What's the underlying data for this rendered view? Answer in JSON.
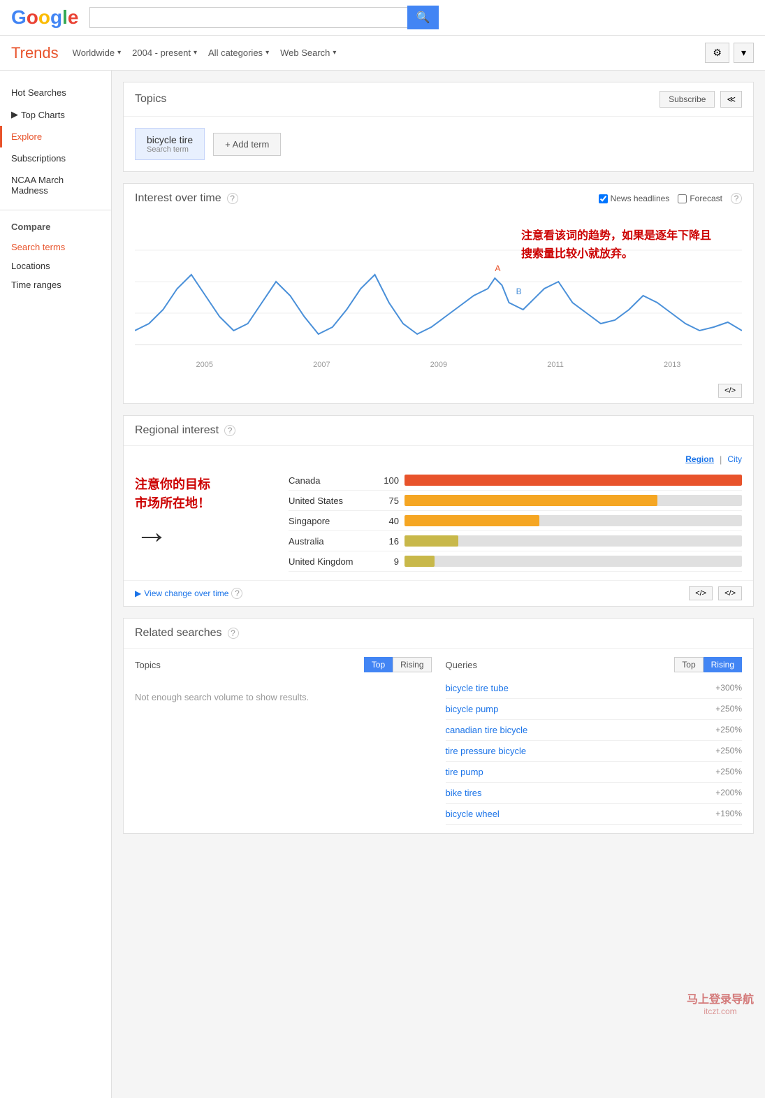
{
  "header": {
    "search_placeholder": "",
    "search_btn_icon": "🔍"
  },
  "google_logo": {
    "text": "Google"
  },
  "trends_bar": {
    "logo": "Trends",
    "nav": [
      {
        "label": "Worldwide",
        "has_arrow": true
      },
      {
        "label": "2004 - present",
        "has_arrow": true
      },
      {
        "label": "All categories",
        "has_arrow": true
      },
      {
        "label": "Web Search",
        "has_arrow": true
      }
    ],
    "settings_icon": "⚙",
    "arrow_icon": "▾"
  },
  "sidebar": {
    "items": [
      {
        "label": "Hot Searches",
        "active": false
      },
      {
        "label": "Top Charts",
        "active": false,
        "has_arrow": true
      },
      {
        "label": "Explore",
        "active": true
      },
      {
        "label": "Subscriptions",
        "active": false
      },
      {
        "label": "NCAA March Madness",
        "active": false
      }
    ],
    "compare_label": "Compare",
    "compare_items": [
      {
        "label": "Search terms",
        "active": true
      },
      {
        "label": "Locations",
        "active": false
      },
      {
        "label": "Time ranges",
        "active": false
      }
    ]
  },
  "topics": {
    "title": "Topics",
    "subscribe_btn": "Subscribe",
    "share_icon": "≪",
    "term": {
      "name": "bicycle tire",
      "type": "Search term"
    },
    "add_term_btn": "+ Add term"
  },
  "interest_over_time": {
    "title": "Interest over time",
    "question_icon": "?",
    "news_headlines_label": "News headlines",
    "forecast_label": "Forecast",
    "question_icon2": "?",
    "annotation": "注意看该词的趋势，如果是逐年下降且\n搜索量比较小就放弃。",
    "years": [
      "2005",
      "2007",
      "2009",
      "2011",
      "2013"
    ],
    "embed_icon": "</>",
    "news_checked": true,
    "forecast_checked": false
  },
  "regional_interest": {
    "title": "Regional interest",
    "question_icon": "?",
    "region_label": "Region",
    "city_label": "City",
    "annotation_text": "注意你的目标\n市场所在地！",
    "arrow": "→",
    "countries": [
      {
        "name": "Canada",
        "score": 100,
        "bar_pct": 100,
        "color": "#e8532b"
      },
      {
        "name": "United States",
        "score": 75,
        "bar_pct": 75,
        "color": "#f5a623"
      },
      {
        "name": "Singapore",
        "score": 40,
        "bar_pct": 40,
        "color": "#f5a623"
      },
      {
        "name": "Australia",
        "score": 16,
        "bar_pct": 16,
        "color": "#c8b84a"
      },
      {
        "name": "United Kingdom",
        "score": 9,
        "bar_pct": 9,
        "color": "#c8b84a"
      }
    ],
    "view_change_label": "View change over time",
    "question_icon2": "?",
    "embed_icon": "</>",
    "embed_icon2": "</>"
  },
  "related_searches": {
    "title": "Related searches",
    "question_icon": "?",
    "topics_label": "Topics",
    "top_btn": "Top",
    "rising_btn": "Rising",
    "queries_label": "Queries",
    "top_btn2": "Top",
    "rising_btn2": "Rising",
    "no_data": "Not enough search volume to show results.",
    "queries": [
      {
        "term": "bicycle tire tube",
        "pct": "+300%"
      },
      {
        "term": "bicycle pump",
        "pct": "+250%"
      },
      {
        "term": "canadian tire bicycle",
        "pct": "+250%"
      },
      {
        "term": "tire pressure bicycle",
        "pct": "+250%"
      },
      {
        "term": "tire pump",
        "pct": "+250%"
      },
      {
        "term": "bike tires",
        "pct": "+200%"
      },
      {
        "term": "bicycle wheel",
        "pct": "+190%"
      }
    ]
  },
  "watermark": {
    "line1": "马上登录导航",
    "line2": "itczt.com"
  }
}
